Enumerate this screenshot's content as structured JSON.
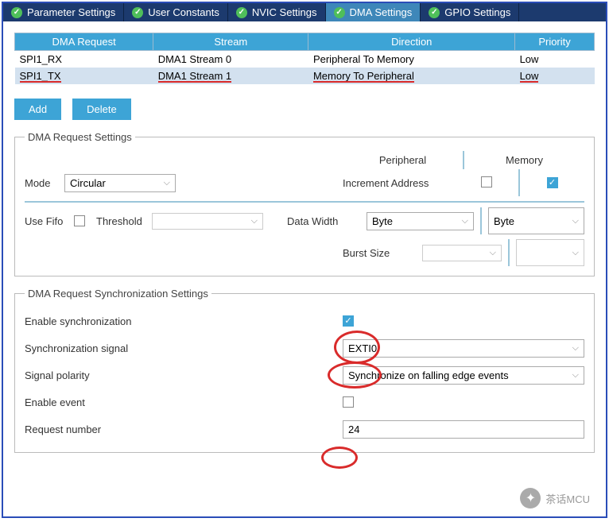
{
  "tabs": {
    "t0": "Parameter Settings",
    "t1": "User Constants",
    "t2": "NVIC Settings",
    "t3": "DMA Settings",
    "t4": "GPIO Settings"
  },
  "table": {
    "h0": "DMA Request",
    "h1": "Stream",
    "h2": "Direction",
    "h3": "Priority",
    "r0": {
      "req": "SPI1_RX",
      "stream": "DMA1 Stream 0",
      "dir": "Peripheral To Memory",
      "prio": "Low"
    },
    "r1": {
      "req": "SPI1_TX",
      "stream": "DMA1 Stream 1",
      "dir": "Memory To Peripheral",
      "prio": "Low"
    }
  },
  "buttons": {
    "add": "Add",
    "delete": "Delete"
  },
  "req_settings": {
    "legend": "DMA Request Settings",
    "col_peripheral": "Peripheral",
    "col_memory": "Memory",
    "mode_label": "Mode",
    "mode_value": "Circular",
    "inc_addr": "Increment Address",
    "use_fifo": "Use Fifo",
    "threshold": "Threshold",
    "data_width": "Data Width",
    "data_width_p": "Byte",
    "data_width_m": "Byte",
    "burst": "Burst Size"
  },
  "sync": {
    "legend": "DMA Request Synchronization Settings",
    "enable_sync": "Enable synchronization",
    "sync_signal": "Synchronization signal",
    "sync_signal_val": "EXTI0",
    "signal_polarity": "Signal polarity",
    "signal_polarity_val": "Synchronize on falling edge events",
    "enable_event": "Enable event",
    "request_number": "Request number",
    "request_number_val": "24"
  },
  "watermark": "茶话MCU"
}
